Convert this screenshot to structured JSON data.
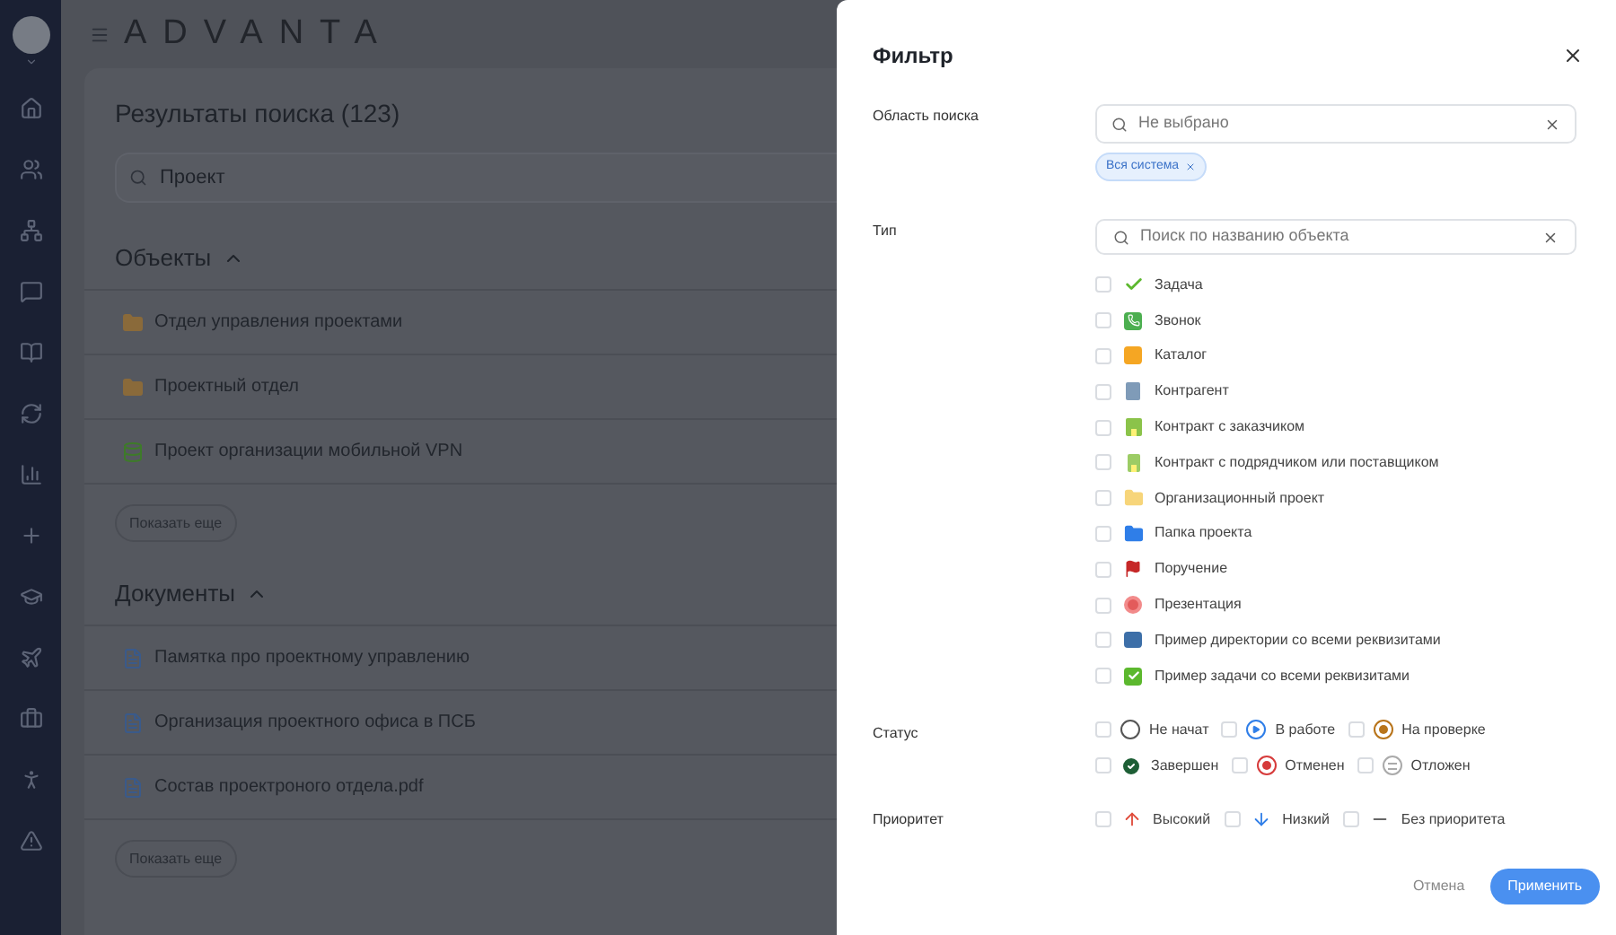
{
  "logo": "ADVANTA",
  "page": {
    "title": "Результаты поиска (123)",
    "search": {
      "value": "Проект"
    },
    "sections": [
      {
        "title": "Объекты",
        "expanded": true,
        "items": [
          {
            "kind": "folder",
            "label": "Отдел управления проектами"
          },
          {
            "kind": "folder",
            "label": "Проектный отдел"
          },
          {
            "kind": "database",
            "label": "Проект организации мобильной VPN"
          }
        ],
        "more": "Показать еще"
      },
      {
        "title": "Документы",
        "expanded": true,
        "items": [
          {
            "kind": "document",
            "label": "Памятка про проектному управлению"
          },
          {
            "kind": "document",
            "label": "Организация проектного офиса в ПСБ"
          },
          {
            "kind": "document",
            "label": "Состав проектроного отдела.pdf"
          }
        ],
        "more": "Показать еще"
      }
    ]
  },
  "filter": {
    "title": "Фильтр",
    "scope": {
      "label": "Область поиска",
      "placeholder": "Не выбрано",
      "tags": [
        "Вся система"
      ]
    },
    "type": {
      "label": "Тип",
      "placeholder": "Поиск по названию объекта",
      "options": [
        {
          "kind": "task",
          "label": "Задача",
          "checked": false
        },
        {
          "kind": "call",
          "label": "Звонок",
          "checked": false
        },
        {
          "kind": "catalog",
          "label": "Каталог",
          "checked": false
        },
        {
          "kind": "contractor",
          "label": "Контрагент",
          "checked": false
        },
        {
          "kind": "contract-customer",
          "label": "Контракт с заказчиком",
          "checked": false
        },
        {
          "kind": "contract-supplier",
          "label": "Контракт с подрядчиком или поставщиком",
          "checked": false
        },
        {
          "kind": "org-project",
          "label": "Организационный проект",
          "checked": false
        },
        {
          "kind": "project-folder",
          "label": "Папка проекта",
          "checked": false
        },
        {
          "kind": "order",
          "label": "Поручение",
          "checked": false
        },
        {
          "kind": "presentation",
          "label": "Презентация",
          "checked": false
        },
        {
          "kind": "directory",
          "label": "Пример директории со всеми реквизитами",
          "checked": false
        },
        {
          "kind": "task-example",
          "label": "Пример задачи со всеми реквизитами",
          "checked": false
        }
      ]
    },
    "status": {
      "label": "Статус",
      "rows": [
        [
          {
            "kind": "not-started",
            "label": "Не начат",
            "checked": false
          },
          {
            "kind": "in-progress",
            "label": "В работе",
            "checked": false
          },
          {
            "kind": "review",
            "label": "На проверке",
            "checked": false
          }
        ],
        [
          {
            "kind": "done",
            "label": "Завершен",
            "checked": false
          },
          {
            "kind": "cancelled",
            "label": "Отменен",
            "checked": false
          },
          {
            "kind": "postponed",
            "label": "Отложен",
            "checked": false
          }
        ]
      ]
    },
    "priority": {
      "label": "Приоритет",
      "options": [
        {
          "kind": "high",
          "label": "Высокий",
          "checked": false
        },
        {
          "kind": "low",
          "label": "Низкий",
          "checked": false
        },
        {
          "kind": "none",
          "label": "Без приоритета",
          "checked": false
        }
      ]
    },
    "cancel": "Отмена",
    "apply": "Применить"
  }
}
